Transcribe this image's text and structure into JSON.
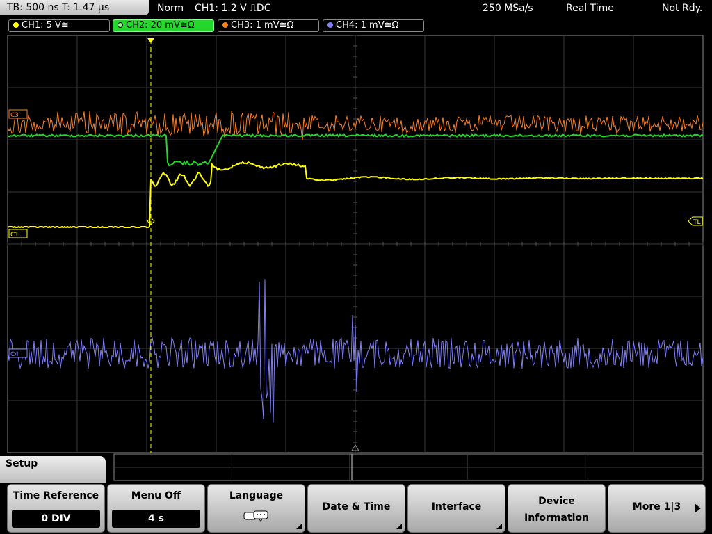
{
  "topbar": {
    "timebase": "TB: 500 ns   T: 1.47 µs",
    "mode": "Norm",
    "trigger": "CH1: 1.2 V ⎍DC",
    "sample_rate": "250 MSa/s",
    "acq_mode": "Real Time",
    "status": "Not Rdy."
  },
  "channels": [
    {
      "label": "CH1: 5 V≅",
      "color": "#ffff00"
    },
    {
      "label": "CH2: 20 mV≅Ω",
      "color": "#22d82b"
    },
    {
      "label": "CH3: 1 mV≅Ω",
      "color": "#ff7f27"
    },
    {
      "label": "CH4: 1 mV≅Ω",
      "color": "#8080ff"
    }
  ],
  "markers": {
    "trigger": "T",
    "trigger_level": "TL",
    "c1": "C1",
    "c3": "C3",
    "c4": "C4"
  },
  "menu": {
    "title": "Setup",
    "time_reference": {
      "label": "Time Reference",
      "value": "0 DIV"
    },
    "menu_off": {
      "label": "Menu Off",
      "value": "4 s"
    },
    "language": {
      "label": "Language",
      "icon": "speech-bubbles-icon"
    },
    "date_time": "Date & Time",
    "interface": "Interface",
    "device_info_line1": "Device",
    "device_info_line2": "Information",
    "more": "More 1|3"
  }
}
